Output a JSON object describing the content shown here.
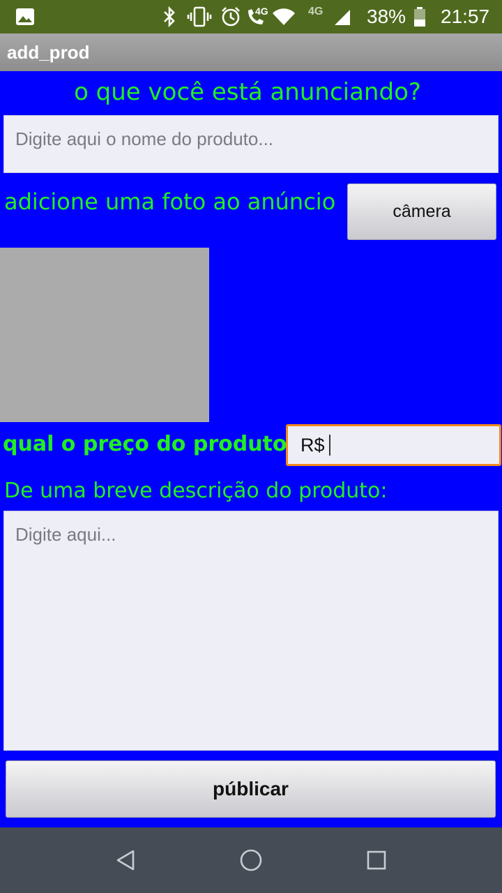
{
  "status_bar": {
    "battery": "38%",
    "time": "21:57",
    "network_4g_1": "4G",
    "network_4g_2": "4G"
  },
  "action_bar": {
    "title": "add_prod"
  },
  "form": {
    "heading": "o que você está anunciando?",
    "name_placeholder": "Digite aqui o nome do produto...",
    "photo_label": "adicione uma foto ao anúncio",
    "camera_button": "câmera",
    "price_label": "qual o preço do produto?",
    "price_value": "R$",
    "description_label": "De uma breve descrição do produto:",
    "description_placeholder": "Digite aqui...",
    "publish_button": "públicar"
  },
  "colors": {
    "background": "#0000ff",
    "label_green": "#22ee22",
    "status_bar": "#4f6a1e",
    "nav_bar": "#454c55",
    "focus_orange": "#f28a1e"
  },
  "icons": {
    "status": [
      "image-icon",
      "bluetooth-icon",
      "vibrate-icon",
      "alarm-icon",
      "volte-call-icon",
      "wifi-icon",
      "signal-icon",
      "battery-icon"
    ],
    "nav": [
      "back-icon",
      "home-icon",
      "recents-icon"
    ]
  }
}
